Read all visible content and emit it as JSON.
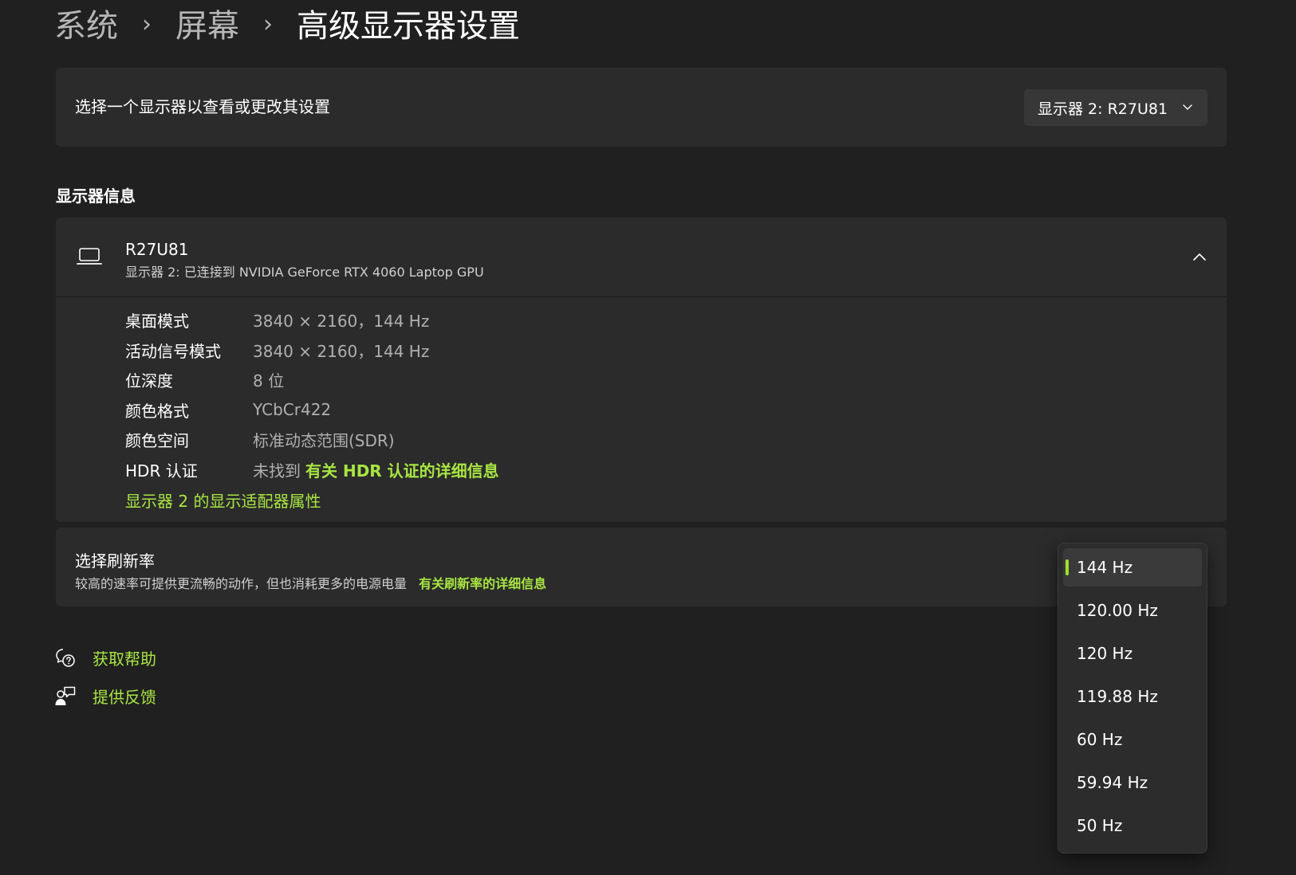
{
  "breadcrumb": {
    "items": [
      "系统",
      "屏幕"
    ],
    "current": "高级显示器设置"
  },
  "monitor_select": {
    "label": "选择一个显示器以查看或更改其设置",
    "selected": "显示器 2: R27U81"
  },
  "display_info": {
    "heading": "显示器信息",
    "name": "R27U81",
    "subtitle": "显示器 2: 已连接到 NVIDIA GeForce RTX 4060 Laptop GPU",
    "rows": [
      {
        "label": "桌面模式",
        "value": "3840 × 2160，144 Hz"
      },
      {
        "label": "活动信号模式",
        "value": "3840 × 2160，144 Hz"
      },
      {
        "label": "位深度",
        "value": "8 位"
      },
      {
        "label": "颜色格式",
        "value": "YCbCr422"
      },
      {
        "label": "颜色空间",
        "value": "标准动态范围(SDR)"
      }
    ],
    "hdr": {
      "label": "HDR 认证",
      "value": "未找到",
      "link": "有关 HDR 认证的详细信息"
    },
    "adapter_link": "显示器 2 的显示适配器属性"
  },
  "refresh": {
    "title": "选择刷新率",
    "description": "较高的速率可提供更流畅的动作，但也消耗更多的电源电量",
    "link": "有关刷新率的详细信息",
    "options": [
      "144 Hz",
      "120.00 Hz",
      "120 Hz",
      "119.88 Hz",
      "60 Hz",
      "59.94 Hz",
      "50 Hz"
    ],
    "selected": "144 Hz"
  },
  "footer": {
    "help": "获取帮助",
    "feedback": "提供反馈"
  },
  "colors": {
    "background": "#202020",
    "card": "#2b2b2b",
    "accent": "#a8e542",
    "indicator": "#9be32a"
  }
}
